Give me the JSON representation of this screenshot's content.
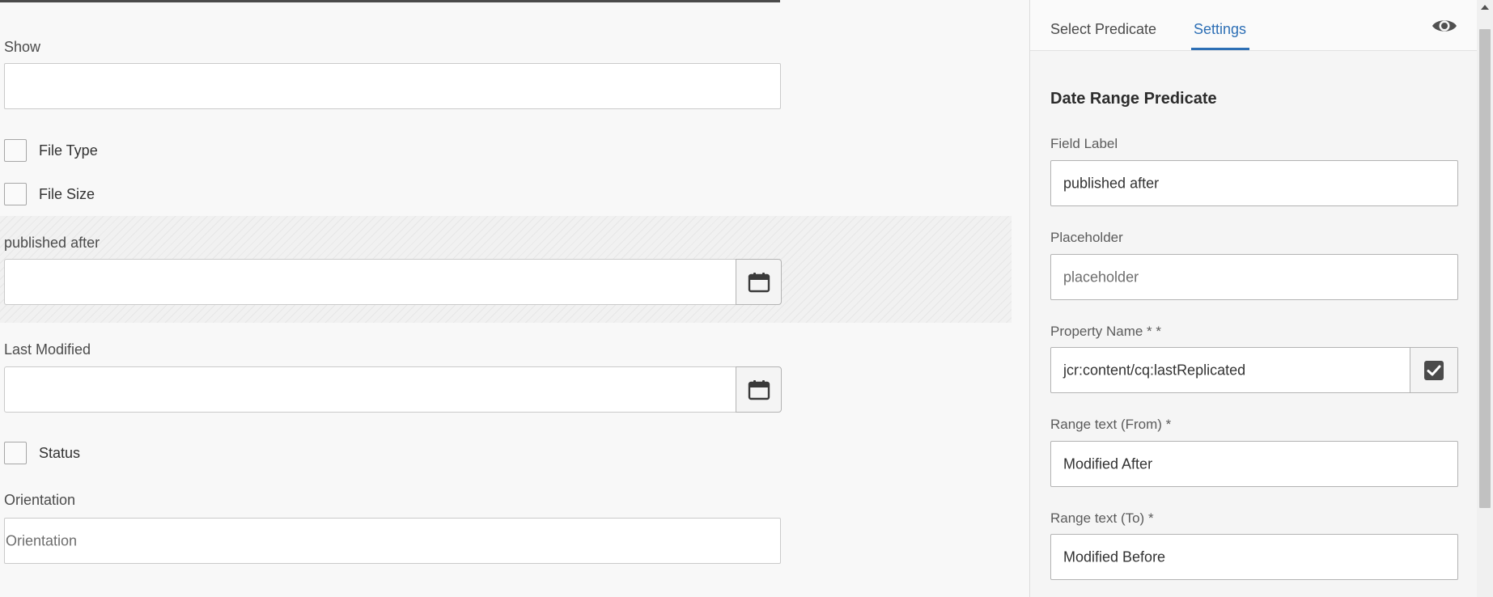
{
  "form": {
    "show_label": "Show",
    "show_value": "",
    "checkboxes": [
      {
        "label": "File Type",
        "checked": false
      },
      {
        "label": "File Size",
        "checked": false
      },
      {
        "label": "Status",
        "checked": false
      }
    ],
    "published_after_label": "published after",
    "published_after_value": "",
    "last_modified_label": "Last Modified",
    "last_modified_value": "",
    "orientation_label": "Orientation",
    "orientation_placeholder": "Orientation"
  },
  "panel": {
    "tabs": [
      "Select Predicate",
      "Settings"
    ],
    "active_tab": "Settings",
    "title": "Date Range Predicate",
    "field_label": {
      "label": "Field Label",
      "value": "published after"
    },
    "placeholder": {
      "label": "Placeholder",
      "placeholder": "placeholder"
    },
    "property_name": {
      "label": "Property Name * *",
      "value": "jcr:content/cq:lastReplicated",
      "checked": true
    },
    "range_from": {
      "label": "Range text (From) *",
      "value": "Modified After"
    },
    "range_to": {
      "label": "Range text (To) *",
      "value": "Modified Before"
    }
  },
  "colors": {
    "accent": "#2d6fb5",
    "background": "#f8f8f8",
    "border": "#cacaca"
  },
  "icons": [
    "calendar-icon",
    "eye-icon",
    "checkmark-icon"
  ]
}
